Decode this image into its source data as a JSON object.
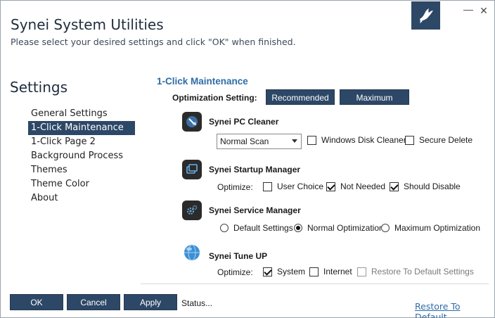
{
  "window": {
    "title": "Synei System Utilities",
    "subtitle": "Please select your desired settings and click \"OK\" when finished.",
    "minimize_glyph": "—",
    "close_glyph": "✕"
  },
  "sidebar": {
    "heading": "Settings",
    "items": [
      {
        "label": "General Settings"
      },
      {
        "label": "1-Click Maintenance"
      },
      {
        "label": "1-Click Page 2"
      },
      {
        "label": "Background Process"
      },
      {
        "label": "Themes"
      },
      {
        "label": "Theme Color"
      },
      {
        "label": "About"
      }
    ],
    "active_index": 1
  },
  "main": {
    "section_title": "1-Click Maintenance",
    "optimization_label": "Optimization Setting:",
    "recommended_label": "Recommended",
    "maximum_label": "Maximum",
    "pc_cleaner": {
      "title": "Synei PC Cleaner",
      "icon": "broom-icon",
      "scan_selected": "Normal Scan",
      "windows_disk_cleaner": {
        "label": "Windows Disk Cleaner",
        "checked": false
      },
      "secure_delete": {
        "label": "Secure Delete",
        "checked": false
      }
    },
    "startup_manager": {
      "title": "Synei Startup Manager",
      "icon": "windows-stack-icon",
      "optimize_label": "Optimize:",
      "user_choice": {
        "label": "User Choice",
        "checked": false
      },
      "not_needed": {
        "label": "Not Needed",
        "checked": true
      },
      "should_disable": {
        "label": "Should Disable",
        "checked": true
      }
    },
    "service_manager": {
      "title": "Synei Service Manager",
      "icon": "gears-icon",
      "default_settings": {
        "label": "Default Settings",
        "selected": false
      },
      "normal_optimization": {
        "label": "Normal Optimization",
        "selected": true
      },
      "maximum_optimization": {
        "label": "Maximum Optimization",
        "selected": false
      }
    },
    "tune_up": {
      "title": "Synei Tune UP",
      "icon": "globe-icon",
      "optimize_label": "Optimize:",
      "system": {
        "label": "System",
        "checked": true
      },
      "internet": {
        "label": "Internet",
        "checked": false
      },
      "restore_default": {
        "label": "Restore To Default Settings",
        "checked": false,
        "disabled": true
      }
    }
  },
  "footer": {
    "ok_label": "OK",
    "cancel_label": "Cancel",
    "apply_label": "Apply",
    "status_text": "Status...",
    "restore_link": "Restore To Default"
  },
  "colors": {
    "accent_navy": "#2d4767",
    "heading_blue": "#2f6ca7"
  }
}
